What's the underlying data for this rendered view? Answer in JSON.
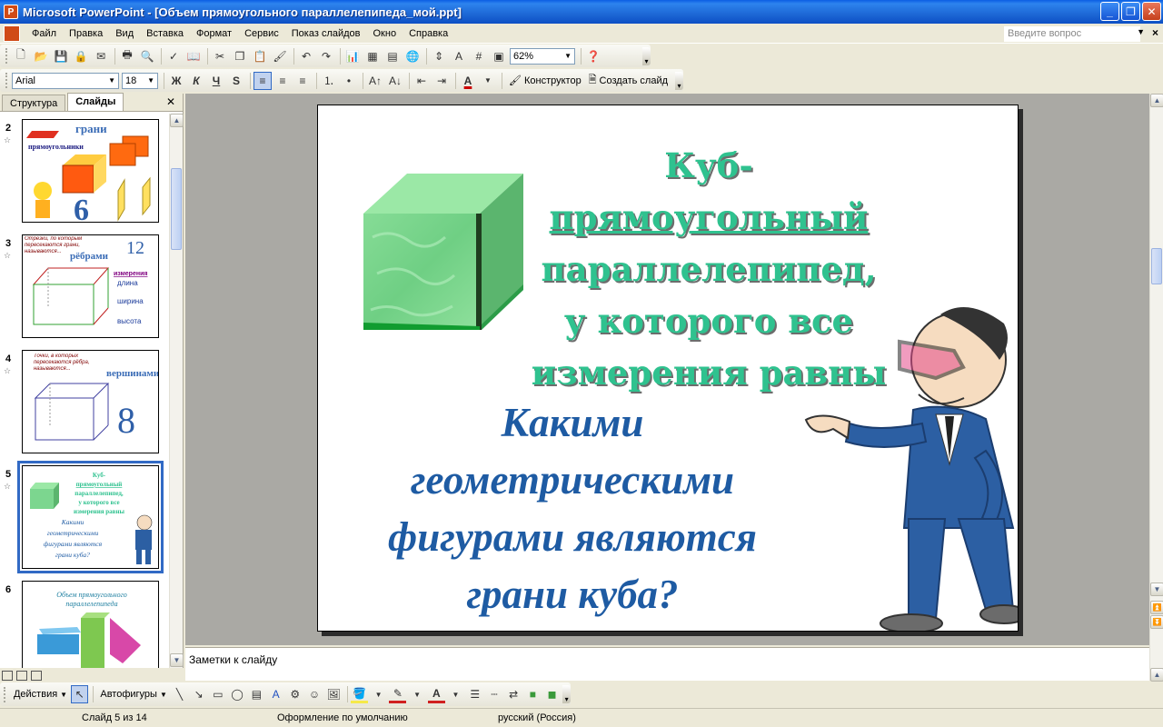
{
  "window": {
    "title": "Microsoft PowerPoint - [Объем прямоугольного параллелепипеда_мой.ppt]",
    "controls": {
      "minimize": "_",
      "maximize": "❐",
      "close": "✕"
    }
  },
  "menubar": {
    "items": [
      "Файл",
      "Правка",
      "Вид",
      "Вставка",
      "Формат",
      "Сервис",
      "Показ слайдов",
      "Окно",
      "Справка"
    ],
    "ask_placeholder": "Введите вопрос"
  },
  "standard_toolbar": {
    "zoom": "62%"
  },
  "formatting_toolbar": {
    "font": "Arial",
    "size": "18",
    "bold": "Ж",
    "italic": "К",
    "underline": "Ч",
    "shadow": "S",
    "designer": "Конструктор",
    "new_slide": "Создать слайд"
  },
  "left_panel": {
    "tabs": [
      "Структура",
      "Слайды"
    ],
    "active_tab": "Слайды",
    "slides": [
      {
        "number": "2",
        "texts": [
          "грани",
          "прямоугольники",
          "6"
        ]
      },
      {
        "number": "3",
        "texts": [
          "Отрезки, по которым пересекаются грани, называются...",
          "рёбрами",
          "12",
          "измерения",
          "длина",
          "ширина",
          "высота"
        ]
      },
      {
        "number": "4",
        "texts": [
          "Точки, в которых пересекаются рёбра, называются...",
          "вершинами",
          "8"
        ]
      },
      {
        "number": "5",
        "texts": [
          "Куб-",
          "прямоугольный",
          "параллелепипед,",
          "у которого все",
          "измерения равны",
          "Какими",
          "геометрическими",
          "фигурами являются",
          "грани куба?"
        ]
      },
      {
        "number": "6",
        "texts": [
          "Объем прямоугольного параллелепипеда"
        ]
      }
    ],
    "selected_slide": "5"
  },
  "slide": {
    "title_lines": [
      "Куб-",
      "прямоугольный",
      "параллелепипед,",
      "у которого все",
      "измерения равны"
    ],
    "question_lines": [
      "Какими",
      "геометрическими",
      "фигурами являются",
      "грани куба?"
    ],
    "colors": {
      "title": "#2fc28f",
      "question": "#1e5ba3",
      "cube_front": "#7cd68f",
      "cube_top": "#9be8a6",
      "cube_side": "#5bb56e"
    }
  },
  "notes": {
    "placeholder": "Заметки к слайду"
  },
  "drawing_toolbar": {
    "actions": "Действия",
    "autoshapes": "Автофигуры"
  },
  "statusbar": {
    "slide_indicator": "Слайд 5 из 14",
    "design": "Оформление по умолчанию",
    "language": "русский (Россия)"
  }
}
